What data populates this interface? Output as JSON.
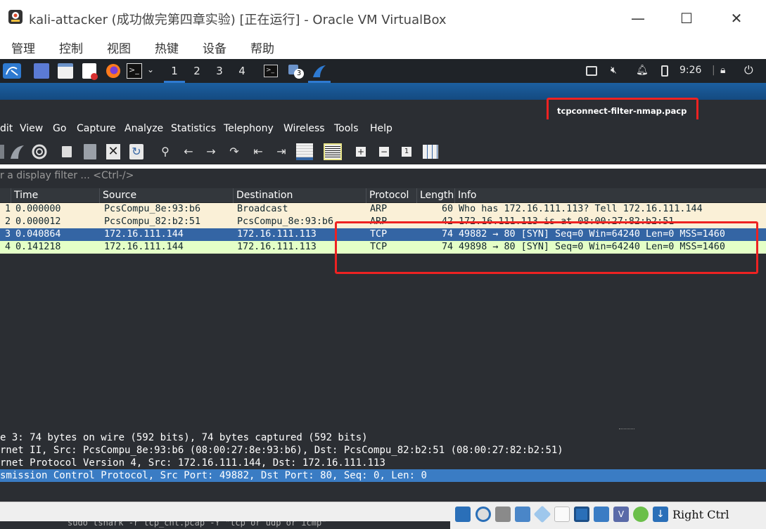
{
  "window": {
    "title": "kali-attacker (成功做完第四章实验) [正在运行] - Oracle VM VirtualBox",
    "minimize": "—",
    "maximize": "☐",
    "close": "✕"
  },
  "vbox_menu": [
    "管理",
    "控制",
    "视图",
    "热键",
    "设备",
    "帮助"
  ],
  "kali_panel": {
    "workspaces": [
      "1",
      "2",
      "3",
      "4"
    ],
    "task_badge": "3",
    "clock": "9:26"
  },
  "wireshark": {
    "annotation": "tcpconnect-filter-nmap.pacp",
    "menu": [
      "dit",
      "View",
      "Go",
      "Capture",
      "Analyze",
      "Statistics",
      "Telephony",
      "Wireless",
      "Tools",
      "Help"
    ],
    "filter_placeholder": "r a display filter ... <Ctrl-/>",
    "columns": [
      "Time",
      "Source",
      "Destination",
      "Protocol",
      "Length",
      "Info"
    ],
    "packets": [
      {
        "no": "1",
        "time": "0.000000",
        "source": "PcsCompu_8e:93:b6",
        "destination": "Broadcast",
        "protocol": "ARP",
        "length": "60",
        "info": "Who has 172.16.111.113? Tell 172.16.111.144"
      },
      {
        "no": "2",
        "time": "0.000012",
        "source": "PcsCompu_82:b2:51",
        "destination": "PcsCompu_8e:93:b6",
        "protocol": "ARP",
        "length": "42",
        "info": "172.16.111.113 is at 08:00:27:82:b2:51"
      },
      {
        "no": "3",
        "time": "0.040864",
        "source": "172.16.111.144",
        "destination": "172.16.111.113",
        "protocol": "TCP",
        "length": "74",
        "info": "49882 → 80 [SYN] Seq=0 Win=64240 Len=0 MSS=1460"
      },
      {
        "no": "4",
        "time": "0.141218",
        "source": "172.16.111.144",
        "destination": "172.16.111.113",
        "protocol": "TCP",
        "length": "74",
        "info": "49898 → 80 [SYN] Seq=0 Win=64240 Len=0 MSS=1460"
      }
    ],
    "details": [
      "e 3: 74 bytes on wire (592 bits), 74 bytes captured (592 bits)",
      "rnet II, Src: PcsCompu_8e:93:b6 (08:00:27:8e:93:b6), Dst: PcsCompu_82:b2:51 (08:00:27:82:b2:51)",
      "rnet Protocol Version 4, Src: 172.16.111.144, Dst: 172.16.111.113",
      "smission Control Protocol, Src Port: 49882, Dst Port: 80, Seq: 0, Len: 0"
    ]
  },
  "background_terminal": "sudo tshark -r tcp_cnt.pcap -Y \"tcp or udp or icmp\"",
  "vbox_status": {
    "host_key": "Right Ctrl"
  },
  "colors": {
    "arp_row": "#faf0d7",
    "selected_row": "#3465a4",
    "tcp_row": "#e4ffc7",
    "highlight": "#ee2222"
  }
}
